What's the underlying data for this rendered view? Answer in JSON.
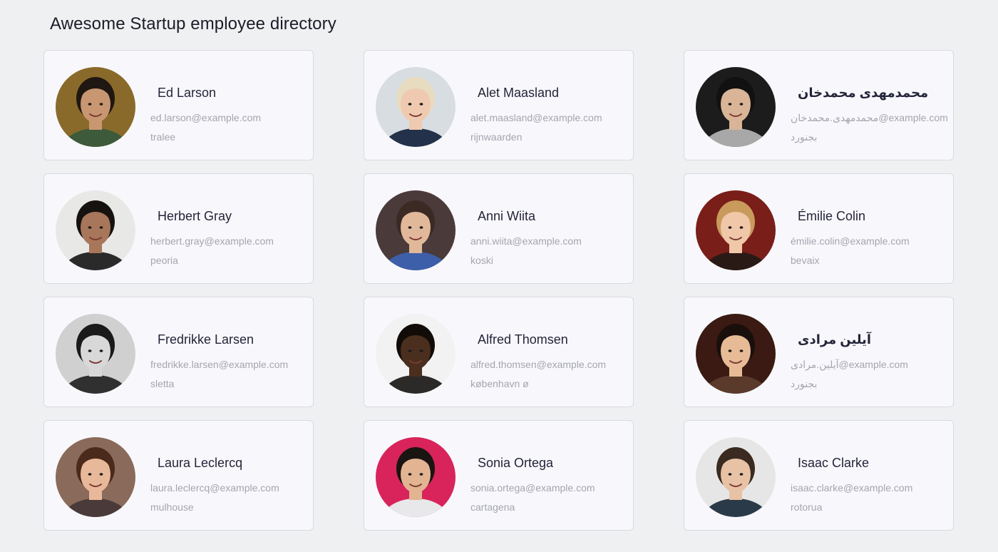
{
  "header": {
    "title": "Awesome Startup employee directory"
  },
  "employees": [
    {
      "name": "Ed Larson",
      "email": "ed.larson@example.com",
      "city": "tralee",
      "avatar_icon": "person-photo",
      "bg": "#8a6a2a",
      "skin": "#c89670",
      "hair": "#1f1712",
      "shirt": "#3d5a3a"
    },
    {
      "name": "Alet Maasland",
      "email": "alet.maasland@example.com",
      "city": "rijnwaarden",
      "avatar_icon": "person-photo",
      "bg": "#d8dde2",
      "skin": "#efcab0",
      "hair": "#e8dcc0",
      "shirt": "#23324a"
    },
    {
      "name": "محمدمهدی محمدخان",
      "email": "محمدمهدی.محمدخان@example.com",
      "city": "بجنورد",
      "avatar_icon": "person-photo",
      "bg": "#1c1c1c",
      "skin": "#d9b497",
      "hair": "#111111",
      "shirt": "#a8a8a8"
    },
    {
      "name": "Herbert Gray",
      "email": "herbert.gray@example.com",
      "city": "peoria",
      "avatar_icon": "person-photo",
      "bg": "#e8e8e6",
      "skin": "#a8765a",
      "hair": "#161210",
      "shirt": "#2a2a2a"
    },
    {
      "name": "Anni Wiita",
      "email": "anni.wiita@example.com",
      "city": "koski",
      "avatar_icon": "person-photo",
      "bg": "#4a3a3a",
      "skin": "#e2b89a",
      "hair": "#3b2a24",
      "shirt": "#3d5ea8"
    },
    {
      "name": "Émilie Colin",
      "email": "émilie.colin@example.com",
      "city": "bevaix",
      "avatar_icon": "person-photo",
      "bg": "#7a1e1a",
      "skin": "#f0c7a8",
      "hair": "#c89a5c",
      "shirt": "#2a1a16"
    },
    {
      "name": "Fredrikke Larsen",
      "email": "fredrikke.larsen@example.com",
      "city": "sletta",
      "avatar_icon": "person-photo",
      "bg": "#d0d0d0",
      "skin": "#d8d8d8",
      "hair": "#1a1a1a",
      "shirt": "#303030"
    },
    {
      "name": "Alfred Thomsen",
      "email": "alfred.thomsen@example.com",
      "city": "københavn ø",
      "avatar_icon": "person-photo",
      "bg": "#f2f2f2",
      "skin": "#4a2e1e",
      "hair": "#120c08",
      "shirt": "#2c2a28"
    },
    {
      "name": "آیلین مرادی",
      "email": "آیلین.مرادی@example.com",
      "city": "بجنورد",
      "avatar_icon": "person-photo",
      "bg": "#3a1a12",
      "skin": "#e6bb96",
      "hair": "#1a0f0c",
      "shirt": "#5a3a2a"
    },
    {
      "name": "Laura Leclercq",
      "email": "laura.leclercq@example.com",
      "city": "mulhouse",
      "avatar_icon": "person-photo",
      "bg": "#8a6a5a",
      "skin": "#e8b89a",
      "hair": "#4a2a1a",
      "shirt": "#4a3a3a"
    },
    {
      "name": "Sonia Ortega",
      "email": "sonia.ortega@example.com",
      "city": "cartagena",
      "avatar_icon": "person-photo",
      "bg": "#d8245a",
      "skin": "#e2b492",
      "hair": "#1a1412",
      "shirt": "#e8e8ea"
    },
    {
      "name": "Isaac Clarke",
      "email": "isaac.clarke@example.com",
      "city": "rotorua",
      "avatar_icon": "person-photo",
      "bg": "#e6e6e6",
      "skin": "#e8c2a4",
      "hair": "#3a2a20",
      "shirt": "#2a3a48"
    }
  ]
}
